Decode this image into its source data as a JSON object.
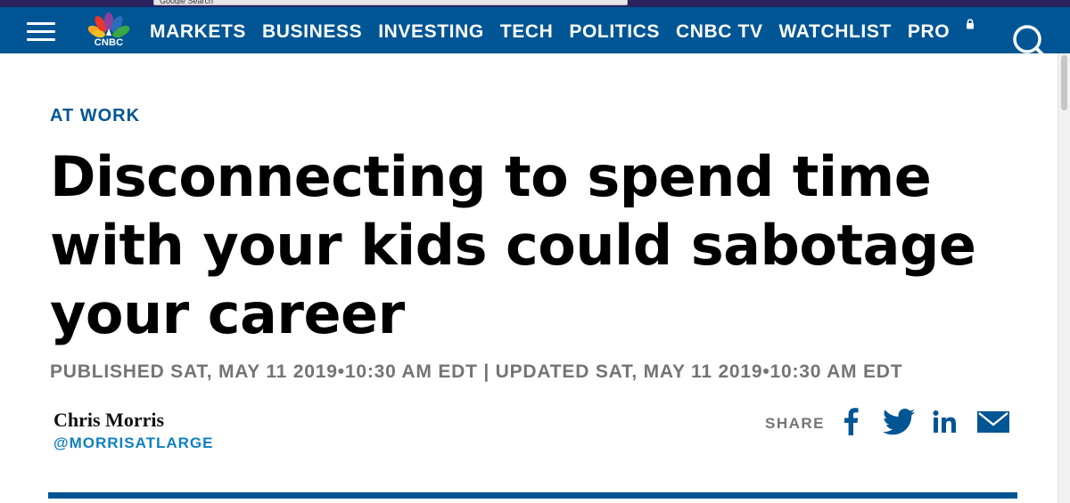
{
  "topbar": {
    "search_text": "Google Search"
  },
  "logo": {
    "text": "CNBC"
  },
  "nav": {
    "items": [
      "MARKETS",
      "BUSINESS",
      "INVESTING",
      "TECH",
      "POLITICS",
      "CNBC TV",
      "WATCHLIST",
      "PRO"
    ]
  },
  "article": {
    "kicker": "AT WORK",
    "headline": "Disconnecting to spend time with your kids could sabotage your career",
    "timestamp": "PUBLISHED SAT, MAY 11 2019•10:30 AM EDT | UPDATED SAT, MAY 11 2019•10:30 AM EDT",
    "author": {
      "name": "Chris Morris",
      "handle": "@MORRISATLARGE"
    }
  },
  "share": {
    "label": "SHARE",
    "icons": [
      "facebook-icon",
      "twitter-icon",
      "linkedin-icon",
      "email-icon"
    ]
  },
  "colors": {
    "nav_bg": "#005594",
    "accent": "#005594",
    "handle": "#0f7fc0",
    "muted": "#747474",
    "top_strip": "#2b2260"
  }
}
